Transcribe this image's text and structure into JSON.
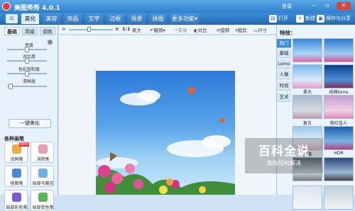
{
  "app": {
    "title": "美图秀秀 4.0.1",
    "login": "登录"
  },
  "nav": {
    "tabs": [
      "美化",
      "美容",
      "饰品",
      "文字",
      "边框",
      "场景",
      "拼图",
      "更多功能"
    ],
    "more_arrow": "▾",
    "open": "打开",
    "new": "新建",
    "save": "保存与分享"
  },
  "left": {
    "tabs": [
      "基础",
      "高级",
      "调色"
    ],
    "sliders": [
      {
        "label": "亮度",
        "value": 0.5
      },
      {
        "label": "对比度",
        "value": 0.5
      },
      {
        "label": "色彩饱和度",
        "value": 0.5
      },
      {
        "label": "清晰度",
        "value": 0.05
      }
    ],
    "oneclick": "一键美化",
    "brush_title": "各种画笔",
    "new_badge": "NEW",
    "tools": [
      "涂鸦笔",
      "消除笔",
      "抠图笔",
      "局部马赛克",
      "局部彩色笔",
      "局部变色笔"
    ]
  },
  "toolbar": {
    "zoom_ratio": "1:1",
    "original": "原大",
    "undo": "撤销",
    "redo": "重做",
    "compare": "对比",
    "crop": "裁剪",
    "crop2": "裁剪",
    "size": "尺寸",
    "rotate": "旋转"
  },
  "fx": {
    "title": "特效：",
    "categories": [
      "热门",
      "基础",
      "Lomo",
      "人像",
      "时尚",
      "艺术"
    ],
    "labels": [
      "",
      "",
      "柔光",
      "经典lomo",
      "",
      "",
      "复古",
      "粉红佳人",
      "",
      "",
      "淡雅",
      "HDR"
    ]
  },
  "watermark": {
    "title": "百科全说",
    "sub": "助你轻松解决"
  },
  "colors": {
    "accent": "#2f7fcf",
    "close": "#d9463c"
  }
}
